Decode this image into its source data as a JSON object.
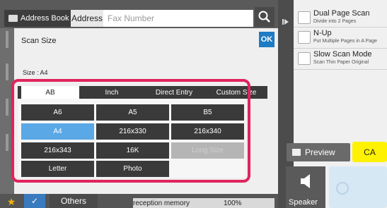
{
  "header": {
    "address_book_label": "Address Book",
    "address_label": "Address",
    "fax_placeholder": "Fax Number"
  },
  "right_panel": {
    "options": [
      {
        "title": "Dual Page Scan",
        "subtitle": "Divide into 2 Pages"
      },
      {
        "title": "N-Up",
        "subtitle": "Put Multiple Pages in A Page"
      },
      {
        "title": "Slow Scan Mode",
        "subtitle": "Scan Thin Paper Original"
      }
    ],
    "preview_label": "Preview",
    "ca_label": "CA",
    "speaker_label": "Speaker"
  },
  "dialog": {
    "title": "Scan Size",
    "ok_label": "OK",
    "size_info": "Size : A4",
    "tabs": [
      {
        "label": "AB",
        "selected": true
      },
      {
        "label": "Inch",
        "selected": false
      },
      {
        "label": "Direct Entry",
        "selected": false
      },
      {
        "label": "Custom Size",
        "selected": false
      }
    ],
    "sizes": [
      {
        "label": "A6",
        "state": "normal"
      },
      {
        "label": "A5",
        "state": "normal"
      },
      {
        "label": "B5",
        "state": "normal"
      },
      {
        "label": "A4",
        "state": "selected"
      },
      {
        "label": "216x330",
        "state": "normal"
      },
      {
        "label": "216x340",
        "state": "normal"
      },
      {
        "label": "216x343",
        "state": "normal"
      },
      {
        "label": "16K",
        "state": "normal"
      },
      {
        "label": "Long Size",
        "state": "disabled"
      },
      {
        "label": "Letter",
        "state": "normal"
      },
      {
        "label": "Photo",
        "state": "normal"
      }
    ]
  },
  "bottom": {
    "others_label": "Others",
    "memory_label": "reception memory",
    "memory_value": "100%"
  },
  "colors": {
    "accent_blue": "#1e7bc4",
    "selected_cell": "#5aa8e6",
    "highlight_frame": "#e0245e",
    "ca_yellow": "#fff200"
  }
}
